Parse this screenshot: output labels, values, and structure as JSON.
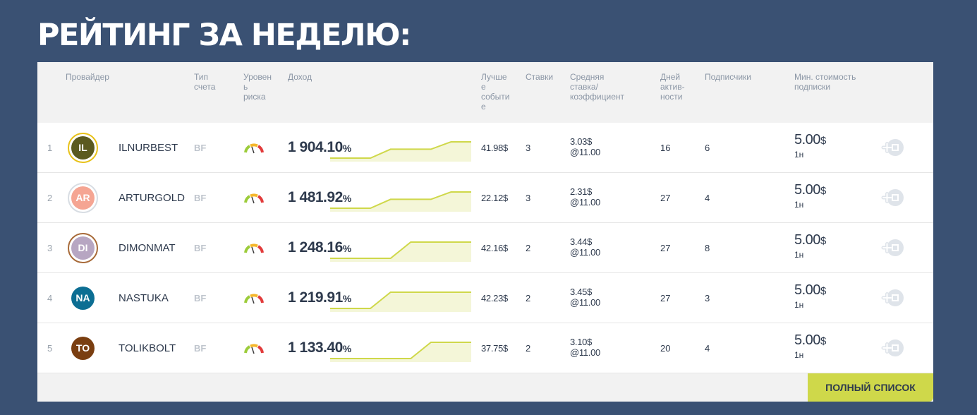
{
  "title": "РЕЙТИНГ ЗА НЕДЕЛЮ:",
  "headers": {
    "provider": "Провайдер",
    "account_type": [
      "Тип",
      "счета"
    ],
    "risk": [
      "Уровен",
      "ь",
      "риска"
    ],
    "income": "Доход",
    "best": [
      "Лучше",
      "е",
      "событи",
      "е"
    ],
    "bets": "Ставки",
    "avg": [
      "Средняя",
      "ставка/",
      "коэффициент"
    ],
    "days": [
      "Дней",
      "актив-",
      "ности"
    ],
    "subscribers": "Подписчики",
    "min_price": [
      "Мин. стоимость",
      "подписки"
    ]
  },
  "rows": [
    {
      "rank": "1",
      "initials": "IL",
      "name": "ILNURBEST",
      "account": "BF",
      "income": "1 904.10",
      "pct": "%",
      "best": "41.98$",
      "bets": "3",
      "avg_stake": "3.03$",
      "avg_odds": "@11.00",
      "days": "16",
      "subs": "6",
      "price": "5.00",
      "currency": "$",
      "period": "1н",
      "avatar_bg": "#5b5a1f",
      "avatar_ring": "#e8c21a",
      "spark": [
        0.0,
        0.0,
        0.0,
        0.55,
        0.55,
        0.55,
        1.0,
        1.0
      ]
    },
    {
      "rank": "2",
      "initials": "AR",
      "name": "ARTURGOLD",
      "account": "BF",
      "income": "1 481.92",
      "pct": "%",
      "best": "22.12$",
      "bets": "3",
      "avg_stake": "2.31$",
      "avg_odds": "@11.00",
      "days": "27",
      "subs": "4",
      "price": "5.00",
      "currency": "$",
      "period": "1н",
      "avatar_bg": "#f5a593",
      "avatar_ring": "#d8dde3",
      "spark": [
        0.0,
        0.0,
        0.0,
        0.55,
        0.55,
        0.55,
        1.0,
        1.0
      ]
    },
    {
      "rank": "3",
      "initials": "DI",
      "name": "DIMONMAT",
      "account": "BF",
      "income": "1 248.16",
      "pct": "%",
      "best": "42.16$",
      "bets": "2",
      "avg_stake": "3.44$",
      "avg_odds": "@11.00",
      "days": "27",
      "subs": "8",
      "price": "5.00",
      "currency": "$",
      "period": "1н",
      "avatar_bg": "#b7a6c2",
      "avatar_ring": "#a86b3a",
      "spark": [
        0.0,
        0.0,
        0.0,
        0.0,
        1.0,
        1.0,
        1.0,
        1.0
      ]
    },
    {
      "rank": "4",
      "initials": "NA",
      "name": "NASTUKA",
      "account": "BF",
      "income": "1 219.91",
      "pct": "%",
      "best": "42.23$",
      "bets": "2",
      "avg_stake": "3.45$",
      "avg_odds": "@11.00",
      "days": "27",
      "subs": "3",
      "price": "5.00",
      "currency": "$",
      "period": "1н",
      "avatar_bg": "#0c6e93",
      "avatar_ring": "#ffffff",
      "spark": [
        0.0,
        0.0,
        0.0,
        1.0,
        1.0,
        1.0,
        1.0,
        1.0
      ]
    },
    {
      "rank": "5",
      "initials": "TO",
      "name": "TOLIKBOLT",
      "account": "BF",
      "income": "1 133.40",
      "pct": "%",
      "best": "37.75$",
      "bets": "2",
      "avg_stake": "3.10$",
      "avg_odds": "@11.00",
      "days": "20",
      "subs": "4",
      "price": "5.00",
      "currency": "$",
      "period": "1н",
      "avatar_bg": "#7a3e10",
      "avatar_ring": "#ffffff",
      "spark": [
        0.0,
        0.0,
        0.0,
        0.0,
        0.0,
        1.0,
        1.0,
        1.0
      ]
    }
  ],
  "footer": {
    "full_list": "ПОЛНЫЙ СПИСОК"
  },
  "colors": {
    "background": "#3a5173",
    "accent": "#cfd84a",
    "spark_line": "#cfd84a",
    "spark_fill": "#f4f6d8"
  }
}
